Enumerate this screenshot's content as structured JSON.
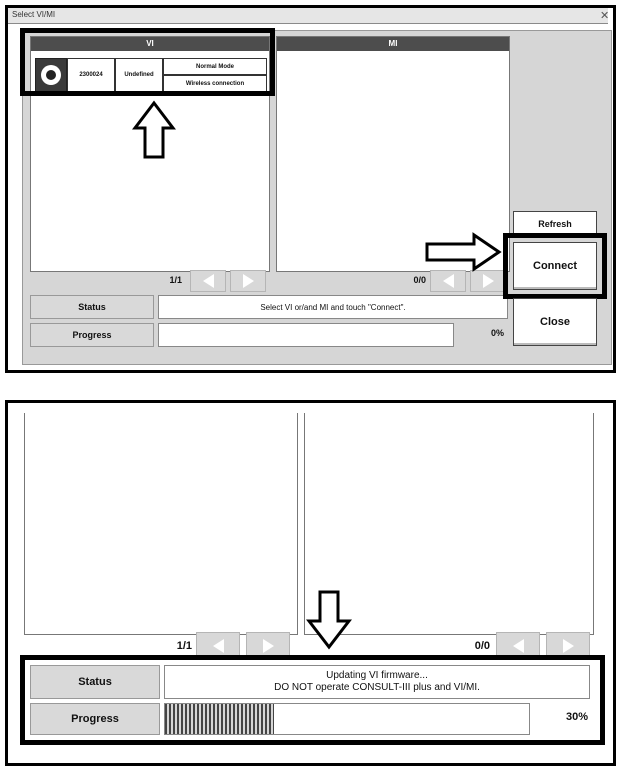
{
  "top": {
    "window_title": "Select VI/MI",
    "vi_header": "VI",
    "mi_header": "MI",
    "vi_row": {
      "id": "2300024",
      "status": "Undefined",
      "mode": "Normal Mode",
      "connection": "Wireless connection"
    },
    "vi_pager": "1/1",
    "mi_pager": "0/0",
    "status_label": "Status",
    "status_text": "Select VI or/and MI and touch \"Connect\".",
    "progress_label": "Progress",
    "progress_text": "0%",
    "progress_fraction": 0,
    "refresh_label": "Refresh",
    "connect_label": "Connect",
    "close_label": "Close"
  },
  "bottom": {
    "vi_pager": "1/1",
    "mi_pager": "0/0",
    "status_label": "Status",
    "status_line1": "Updating VI firmware...",
    "status_line2": "DO NOT operate CONSULT-III plus and VI/MI.",
    "progress_label": "Progress",
    "progress_text": "30%",
    "progress_fraction": 0.3
  },
  "icons": {
    "radio": "radio-selected-icon",
    "arrow_up": "outline-arrow-up-icon",
    "arrow_right": "outline-arrow-right-icon",
    "arrow_down": "outline-arrow-down-icon"
  }
}
